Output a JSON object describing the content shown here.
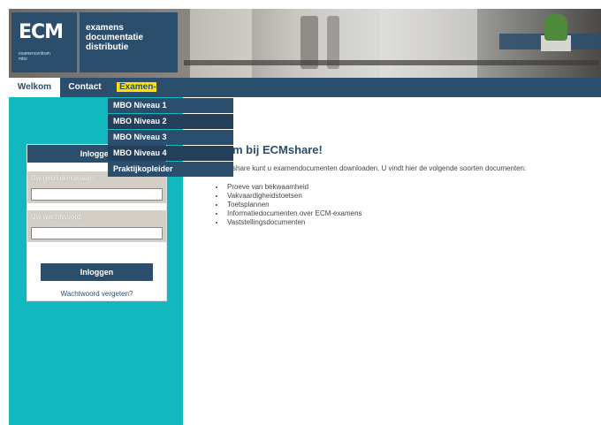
{
  "header": {
    "logo_text": "ECM",
    "logo_subtitle": "examencentrum\nmbo",
    "tagline": [
      "examens",
      "documentatie",
      "distributie"
    ]
  },
  "nav": {
    "items": [
      {
        "label": "Welkom"
      },
      {
        "label": "Contact"
      },
      {
        "label": "Examen-informatie"
      }
    ]
  },
  "dropdown": {
    "items": [
      {
        "label": "MBO Niveau 1"
      },
      {
        "label": "MBO Niveau 2"
      },
      {
        "label": "MBO Niveau 3"
      },
      {
        "label": "MBO Niveau 4"
      },
      {
        "label": "Praktijkopleider"
      }
    ]
  },
  "login": {
    "title": "Inloggen",
    "username_label": "Uw gebruikersnaam:",
    "username_value": "",
    "password_label": "Uw wachtwoord:",
    "password_value": "",
    "button_label": "Inloggen",
    "forgot_link": "Wachtwoord vergeten?"
  },
  "main": {
    "title": "m bij ECMshare!",
    "intro": "share kunt u examendocumenten downloaden. U vindt hier de volgende soorten documenten:",
    "documents": [
      "Proeve van bekwaamheid",
      "Vakvaardigheidstoetsen",
      "Toetsplannen",
      "Informatiedocumenten over ECM-examens",
      "Vaststellingsdocumenten"
    ]
  },
  "colors": {
    "brand_blue": "#2c4e6d",
    "teal": "#12b8bd",
    "highlight": "#ffe000"
  }
}
